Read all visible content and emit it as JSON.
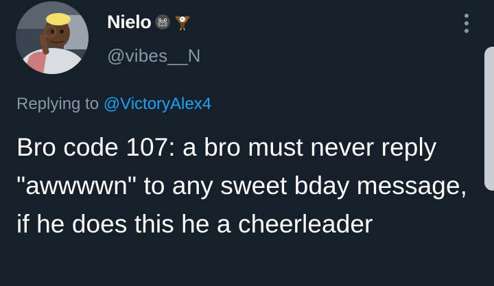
{
  "author": {
    "display_name": "Nielo",
    "badges": [
      "gorilla-emoji",
      "eagle-emoji"
    ],
    "handle": "@vibes__N"
  },
  "reply": {
    "prefix": "Replying to",
    "mention": "@VictoryAlex4"
  },
  "tweet": {
    "text": "Bro code 107: a bro must never reply \"awwwwn\" to any sweet bday message, if he does this he a cheerleader"
  },
  "colors": {
    "background": "#15202b",
    "text": "#ffffff",
    "secondary_text": "#8899a6",
    "link": "#1da1f2"
  },
  "icons": {
    "more": "more-vertical-icon"
  }
}
